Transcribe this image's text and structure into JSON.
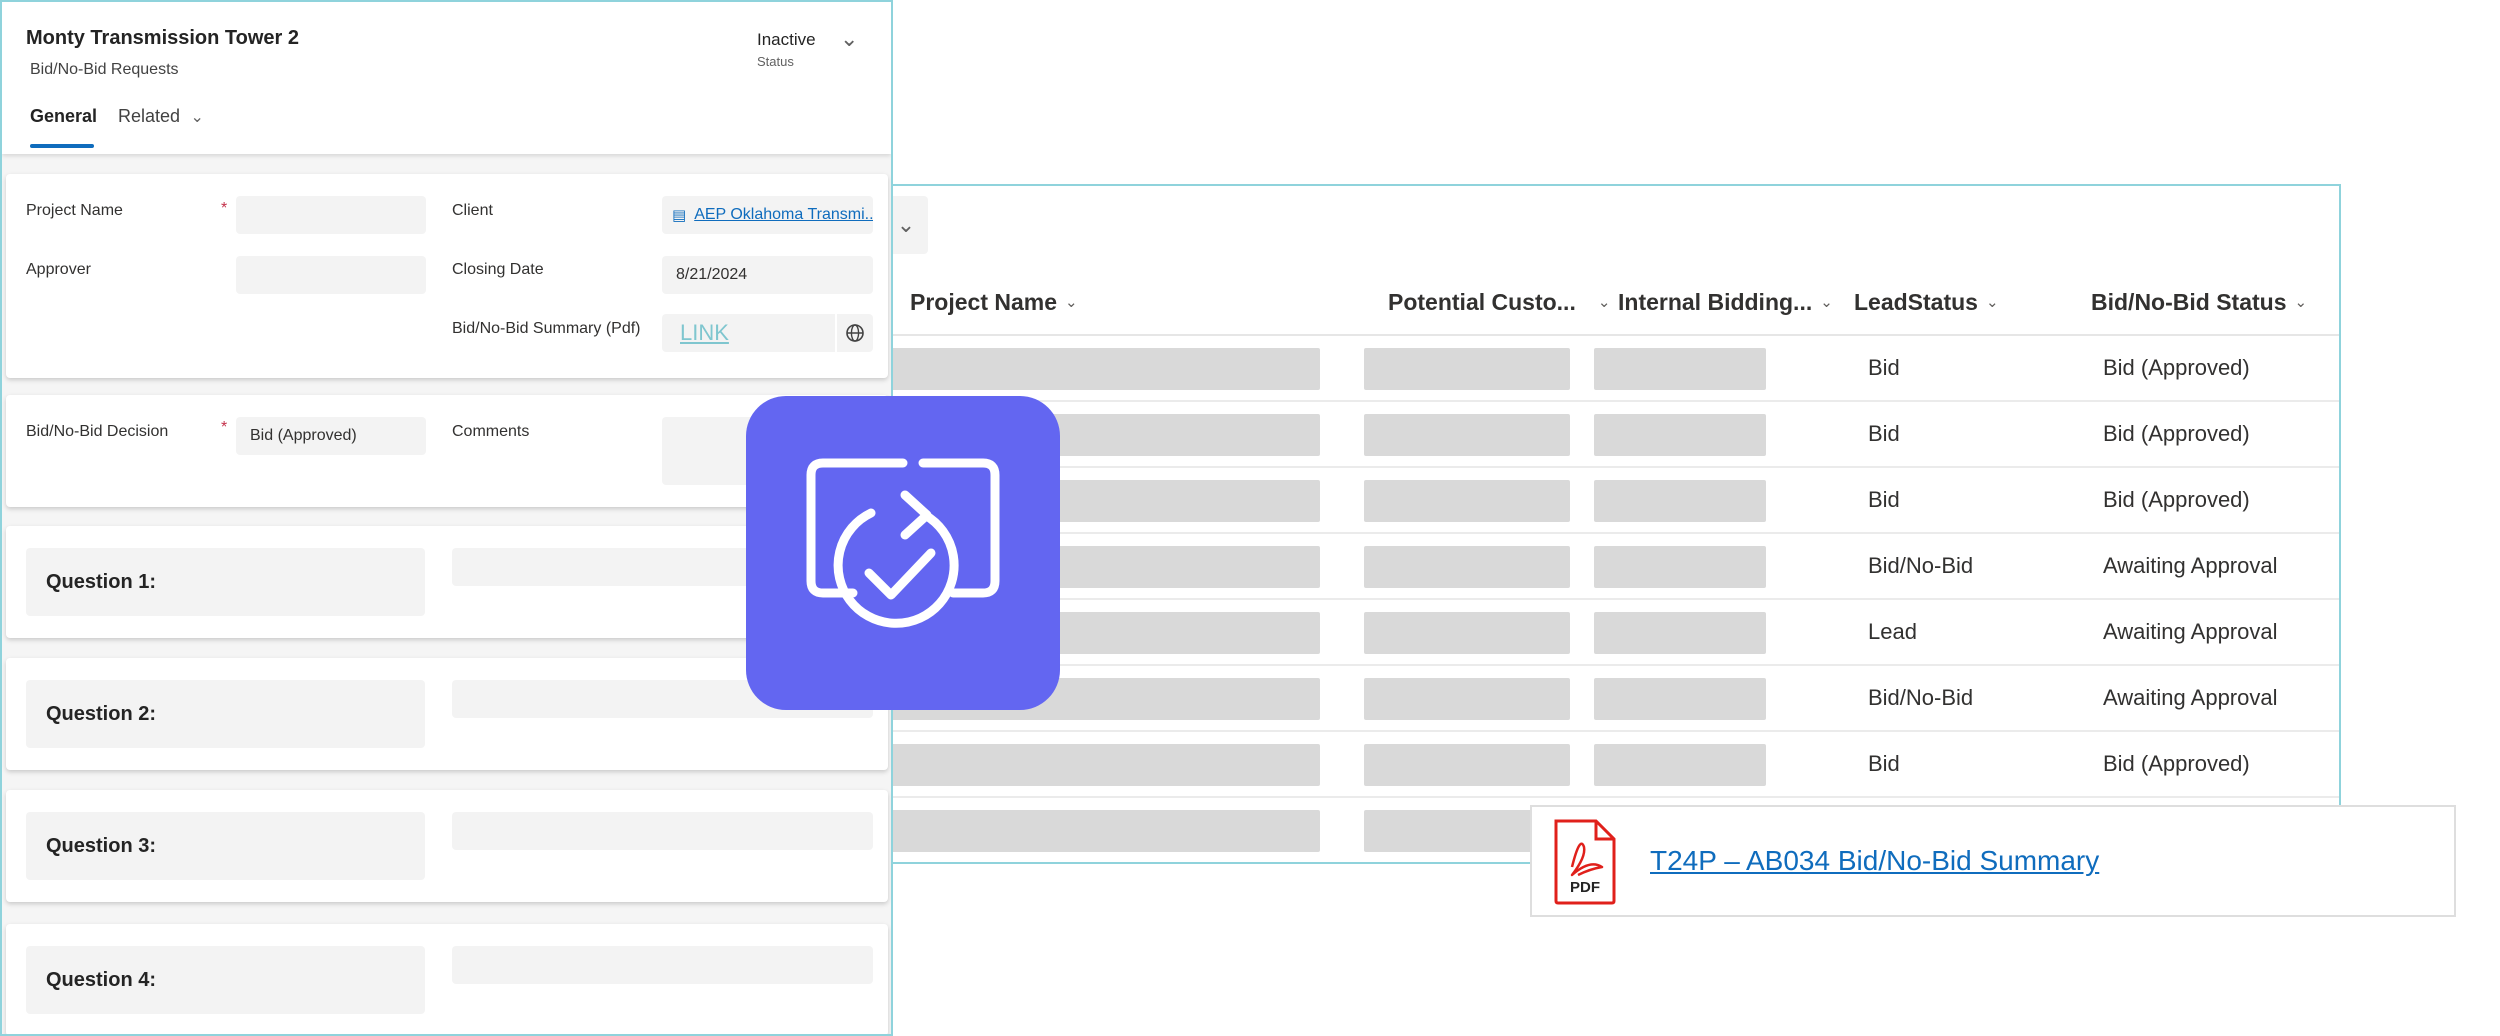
{
  "form": {
    "header": {
      "title": "Monty Transmission Tower 2",
      "subtitle": "Bid/No-Bid Requests",
      "status_value": "Inactive",
      "status_label": "Status"
    },
    "tabs": [
      {
        "label": "General",
        "active": true
      },
      {
        "label": "Related",
        "active": false
      }
    ],
    "fields": {
      "project_name_label": "Project Name",
      "approver_label": "Approver",
      "client_label": "Client",
      "client_value": "AEP Oklahoma Transmi...",
      "closing_date_label": "Closing Date",
      "closing_date_value": "8/21/2024",
      "summary_label": "Bid/No-Bid Summary (Pdf)",
      "summary_value": "LINK",
      "decision_label": "Bid/No-Bid Decision",
      "decision_value": "Bid (Approved)",
      "comments_label": "Comments",
      "required_marker": "*"
    },
    "questions": [
      {
        "label": "Question 1:"
      },
      {
        "label": "Question 2:"
      },
      {
        "label": "Question 3:"
      },
      {
        "label": "Question 4:"
      }
    ]
  },
  "grid": {
    "columns": [
      {
        "label": "Project Name"
      },
      {
        "label": "Potential Custo..."
      },
      {
        "label": "Internal Bidding..."
      },
      {
        "label": "LeadStatus"
      },
      {
        "label": "Bid/No-Bid Status"
      }
    ],
    "rows": [
      {
        "lead_status": "Bid",
        "bid_status": "Bid (Approved)"
      },
      {
        "lead_status": "Bid",
        "bid_status": "Bid (Approved)"
      },
      {
        "lead_status": "Bid",
        "bid_status": "Bid (Approved)"
      },
      {
        "lead_status": "Bid/No-Bid",
        "bid_status": "Awaiting Approval"
      },
      {
        "lead_status": "Lead",
        "bid_status": "Awaiting Approval"
      },
      {
        "lead_status": "Bid/No-Bid",
        "bid_status": "Awaiting Approval"
      },
      {
        "lead_status": "Bid",
        "bid_status": "Bid (Approved)"
      },
      {
        "lead_status": "",
        "bid_status": ""
      }
    ]
  },
  "pdf_attachment": {
    "icon_text": "PDF",
    "link_text": "T24P – AB034 Bid/No-Bid Summary"
  },
  "colors": {
    "accent": "#0f6cbd",
    "app_icon_bg": "#6366f1",
    "panel_border": "#8fd3dc",
    "pdf_red": "#e0201b",
    "link_teal": "#7fc6cf"
  }
}
